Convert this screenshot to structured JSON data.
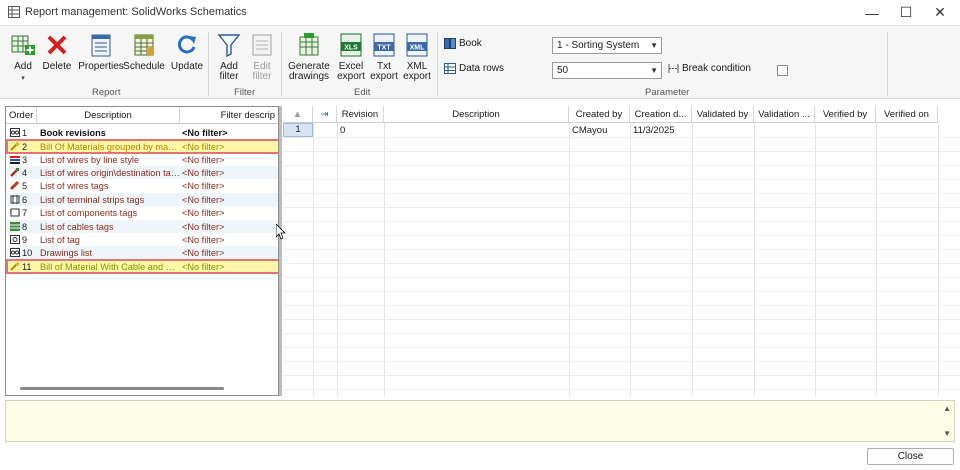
{
  "window": {
    "title": "Report management: SolidWorks Schematics",
    "minimize": "—",
    "maximize": "☐",
    "close": "✕"
  },
  "ribbon": {
    "report_group": "Report",
    "filter_group": "Filter",
    "edit_group": "Edit",
    "parameter_group": "Parameter",
    "add": "Add",
    "delete": "Delete",
    "properties": "Properties",
    "schedule": "Schedule",
    "update": "Update",
    "add_filter_1": "Add",
    "add_filter_2": "filter",
    "edit_filter_1": "Edit",
    "edit_filter_2": "filter",
    "generate_1": "Generate",
    "generate_2": "drawings",
    "excel_1": "Excel",
    "excel_2": "export",
    "txt_1": "Txt",
    "txt_2": "export",
    "xml_1": "XML",
    "xml_2": "export",
    "book_label": "Book",
    "book_value": "1 - Sorting System",
    "data_rows_label": "Data rows",
    "data_rows_value": "50",
    "break_condition_label": "Break condition",
    "excel_badge": "XLS",
    "txt_badge": "TXT",
    "xml_badge": "XML"
  },
  "report_list": {
    "headers": {
      "order": "Order",
      "description": "Description",
      "filter": "Filter descrip"
    },
    "rows": [
      {
        "order": "1",
        "description": "Book revisions",
        "filter": "<No filter>"
      },
      {
        "order": "2",
        "description": "Bill Of Materials grouped by manuf...",
        "filter": "<No filter>"
      },
      {
        "order": "3",
        "description": "List of wires by line style",
        "filter": "<No filter>"
      },
      {
        "order": "4",
        "description": "List of wires origin\\destination tags",
        "filter": "<No filter>"
      },
      {
        "order": "5",
        "description": "List of wires tags",
        "filter": "<No filter>"
      },
      {
        "order": "6",
        "description": "List of terminal strips tags",
        "filter": "<No filter>"
      },
      {
        "order": "7",
        "description": "List of components tags",
        "filter": "<No filter>"
      },
      {
        "order": "8",
        "description": "List of cables tags",
        "filter": "<No filter>"
      },
      {
        "order": "9",
        "description": "List of tag",
        "filter": "<No filter>"
      },
      {
        "order": "10",
        "description": "Drawings list",
        "filter": "<No filter>"
      },
      {
        "order": "11",
        "description": "Bill of Material With Cable and Wires",
        "filter": "<No filter>"
      }
    ]
  },
  "preview_grid": {
    "headers": [
      "Revision",
      "Description",
      "Created by",
      "Creation d...",
      "Validated by",
      "Validation ...",
      "Verified by",
      "Verified on"
    ],
    "row_number": "1",
    "rows": [
      {
        "revision": "0",
        "description": "",
        "created_by": "CMayou",
        "creation_date": "11/3/2025",
        "validated_by": "",
        "validation_date": "",
        "verified_by": "",
        "verified_on": ""
      }
    ]
  },
  "footer": {
    "close": "Close"
  }
}
